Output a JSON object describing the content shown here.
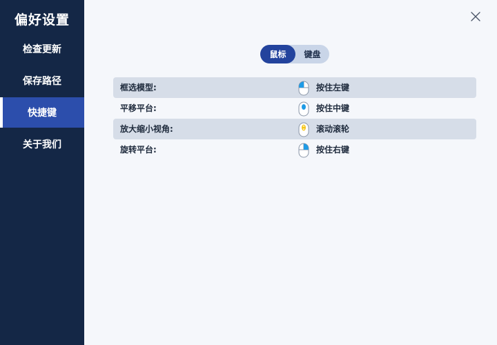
{
  "sidebar": {
    "title": "偏好设置",
    "items": [
      {
        "label": "检查更新",
        "active": false
      },
      {
        "label": "保存路径",
        "active": false
      },
      {
        "label": "快捷键",
        "active": true
      },
      {
        "label": "关于我们",
        "active": false
      }
    ]
  },
  "header": {
    "close_icon": "close-icon"
  },
  "toggle": {
    "options": [
      {
        "label": "鼠标",
        "selected": true
      },
      {
        "label": "键盘",
        "selected": false
      }
    ]
  },
  "shortcuts": [
    {
      "label": "框选模型:",
      "icon": "mouse-left-click-icon",
      "action": "按住左键"
    },
    {
      "label": "平移平台:",
      "icon": "mouse-middle-click-icon",
      "action": "按住中键"
    },
    {
      "label": "放大缩小视角:",
      "icon": "mouse-scroll-icon",
      "action": "滚动滚轮"
    },
    {
      "label": "旋转平台:",
      "icon": "mouse-right-click-icon",
      "action": "按住右键"
    }
  ],
  "colors": {
    "sidebar_bg": "#142746",
    "sidebar_active": "#2c4eac",
    "toggle_active": "#23439d",
    "toggle_bg": "#c9d5e8",
    "row_shaded": "#d6dde8",
    "button_blue": "#1e9be6",
    "wheel_yellow": "#f5c518",
    "content_bg": "#f5f7fb"
  }
}
